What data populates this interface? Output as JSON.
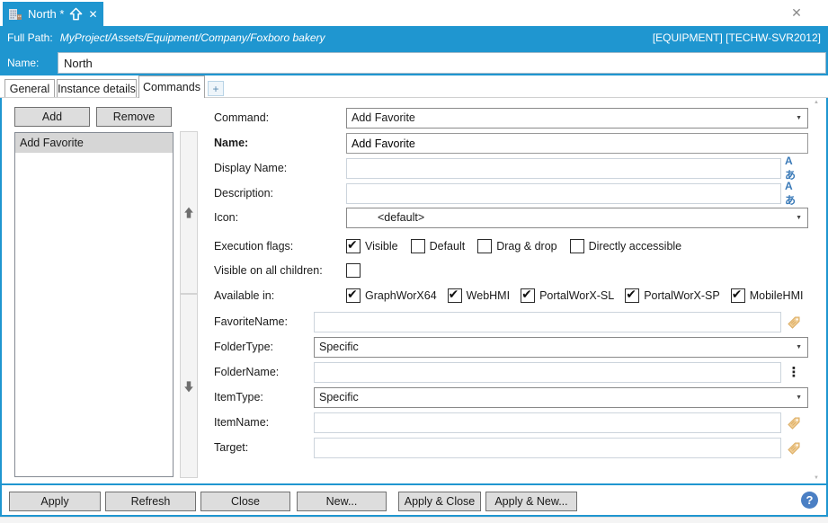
{
  "glyphs": {
    "check": "✔",
    "dropdown": "▼",
    "ellipsis": "⋮",
    "plus": "+",
    "help": "?",
    "close": "✕",
    "scroll_up": "▲",
    "scroll_down": "▼",
    "localize": "Aあ"
  },
  "colors": {
    "accent": "#1f96d0",
    "help_blue": "#4a7fc4",
    "localize_blue": "#3a7ab8",
    "tag_gold": "#eac287"
  },
  "titlebar": {
    "close": "✕"
  },
  "doc_tab": {
    "title": "North *"
  },
  "path_bar": {
    "label": "Full Path:",
    "path": "MyProject/Assets/Equipment/Company/Foxboro bakery",
    "context": "[EQUIPMENT] [TECHW-SVR2012]"
  },
  "name_row": {
    "label": "Name:",
    "value": "North"
  },
  "tabs": {
    "general": "General",
    "instance_details": "Instance details",
    "commands": "Commands",
    "add": "+"
  },
  "commands_panel": {
    "add_button": "Add",
    "remove_button": "Remove",
    "list": [
      {
        "label": "Add Favorite",
        "selected": true
      }
    ]
  },
  "form": {
    "command": {
      "label": "Command:",
      "value": "Add Favorite"
    },
    "name": {
      "label": "Name:",
      "value": "Add Favorite"
    },
    "display_name": {
      "label": "Display Name:",
      "value": ""
    },
    "description": {
      "label": "Description:",
      "value": ""
    },
    "icon": {
      "label": "Icon:",
      "value": "<default>"
    },
    "execution_flags": {
      "label": "Execution flags:",
      "options": [
        {
          "label": "Visible",
          "checked": true
        },
        {
          "label": "Default",
          "checked": false
        },
        {
          "label": "Drag & drop",
          "checked": false
        },
        {
          "label": "Directly accessible",
          "checked": false
        }
      ]
    },
    "visible_on_all_children": {
      "label": "Visible on all children:",
      "checked": false
    },
    "available_in": {
      "label": "Available in:",
      "options": [
        {
          "label": "GraphWorX64",
          "checked": true
        },
        {
          "label": "WebHMI",
          "checked": true
        },
        {
          "label": "PortalWorX-SL",
          "checked": true
        },
        {
          "label": "PortalWorX-SP",
          "checked": true
        },
        {
          "label": "MobileHMI",
          "checked": true
        }
      ]
    },
    "favorite_name": {
      "label": "FavoriteName:",
      "value": ""
    },
    "folder_type": {
      "label": "FolderType:",
      "value": "Specific"
    },
    "folder_name": {
      "label": "FolderName:",
      "value": ""
    },
    "item_type": {
      "label": "ItemType:",
      "value": "Specific"
    },
    "item_name": {
      "label": "ItemName:",
      "value": ""
    },
    "target": {
      "label": "Target:",
      "value": ""
    }
  },
  "footer": {
    "apply": "Apply",
    "refresh": "Refresh",
    "close": "Close",
    "new": "New...",
    "apply_close": "Apply & Close",
    "apply_new": "Apply & New...",
    "help": "?"
  }
}
